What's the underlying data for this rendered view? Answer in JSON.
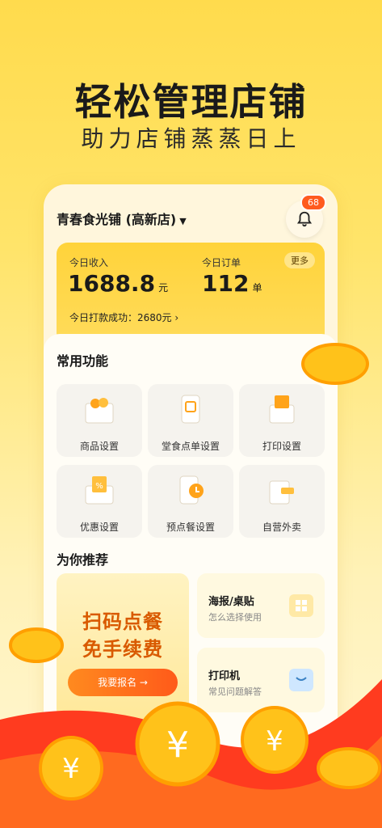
{
  "hero": {
    "title": "轻松管理店铺",
    "subtitle": "助力店铺蒸蒸日上"
  },
  "store": {
    "name": "青春食光铺 (高新店)"
  },
  "notifications": {
    "count": "68"
  },
  "stats": {
    "income_label": "今日收入",
    "income_value": "1688.8",
    "income_unit": "元",
    "orders_label": "今日订单",
    "orders_value": "112",
    "orders_unit": "单",
    "more_label": "更多",
    "payout_text": "今日打款成功：2680元",
    "payout_arrow": "›"
  },
  "common": {
    "title": "常用功能",
    "items": [
      {
        "label": "商品设置",
        "icon": "box-icon"
      },
      {
        "label": "堂食点单设置",
        "icon": "phone-order-icon"
      },
      {
        "label": "打印设置",
        "icon": "printer-icon"
      },
      {
        "label": "优惠设置",
        "icon": "coupon-icon"
      },
      {
        "label": "预点餐设置",
        "icon": "clock-order-icon"
      },
      {
        "label": "自营外卖",
        "icon": "delivery-icon"
      }
    ]
  },
  "recommend": {
    "title": "为你推荐",
    "promo_line1": "扫码点餐",
    "promo_line2": "免手续费",
    "promo_button": "我要报名 →",
    "cards": [
      {
        "title": "海报/桌贴",
        "subtitle": "怎么选择使用",
        "icon": "poster-icon"
      },
      {
        "title": "打印机",
        "subtitle": "常见问题解答",
        "icon": "printer-chat-icon"
      }
    ]
  },
  "colors": {
    "brand": "#ffd33a",
    "accent": "#ff5a1a",
    "promo_text": "#d95a00"
  }
}
